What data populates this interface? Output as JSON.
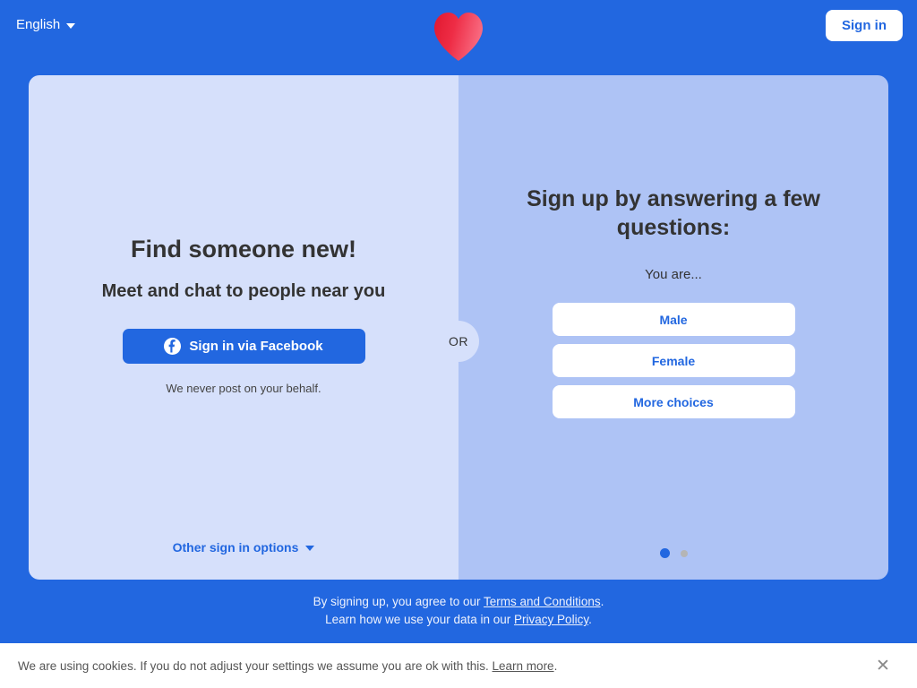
{
  "header": {
    "language_label": "English",
    "language_caret_icon": "chevron-down-icon",
    "logo_icon": "heart-logo-icon",
    "signin_label": "Sign in"
  },
  "left_panel": {
    "title": "Find someone new!",
    "subtitle": "Meet and chat to people near you",
    "facebook_button_label": "Sign in via Facebook",
    "facebook_icon": "facebook-icon",
    "facebook_note": "We never post on your behalf.",
    "other_options_label": "Other sign in options",
    "other_options_caret_icon": "chevron-down-icon"
  },
  "divider": {
    "label": "OR"
  },
  "right_panel": {
    "title": "Sign up by answering a few questions:",
    "question": "You are...",
    "choices": [
      {
        "label": "Male"
      },
      {
        "label": "Female"
      },
      {
        "label": "More choices"
      }
    ],
    "pager": {
      "total": 2,
      "active_index": 0
    }
  },
  "legal": {
    "line1_prefix": "By signing up, you agree to our ",
    "line1_link": "Terms and Conditions",
    "line1_suffix": ".",
    "line2_prefix": "Learn how we use your data in our ",
    "line2_link": "Privacy Policy",
    "line2_suffix": "."
  },
  "cookie_banner": {
    "text_prefix": "We are using cookies. If you do not adjust your settings we assume you are ok with this. ",
    "link_label": "Learn more",
    "text_suffix": ".",
    "close_icon": "close-icon",
    "close_glyph": "✕"
  },
  "colors": {
    "page_background": "#2267e0",
    "panel_left": "#d6e0fb",
    "panel_right": "#aec3f5",
    "accent_blue": "#2267e0",
    "heart_red_dark": "#e8213a",
    "heart_red_light": "#f9617c",
    "button_white": "#ffffff",
    "text_dark": "#333333",
    "dot_inactive": "#b5b5b5"
  }
}
